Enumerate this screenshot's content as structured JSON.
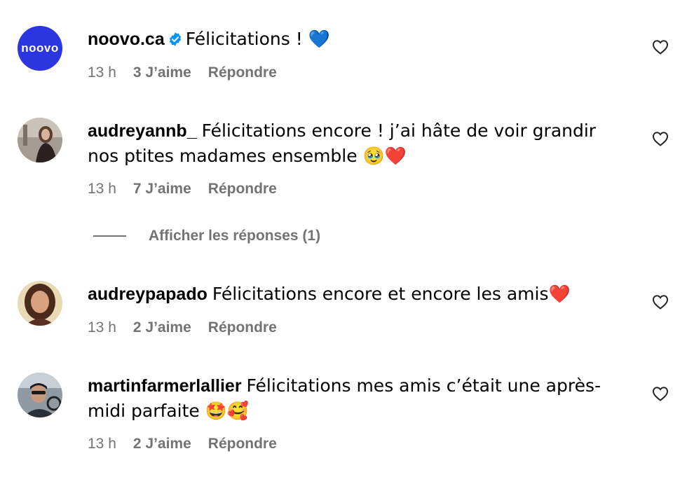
{
  "comments": [
    {
      "username": "noovo.ca",
      "avatar_text": "noovo",
      "verified": true,
      "text": "Félicitations ! 💙",
      "time": "13 h",
      "likes": "3 J’aime",
      "reply": "Répondre"
    },
    {
      "username": "audreyannb_",
      "text": "Félicitations encore ! j’ai hâte de voir grandir nos ptites madames ensemble 🥹❤️",
      "time": "13 h",
      "likes": "7 J’aime",
      "reply": "Répondre"
    },
    {
      "username": "audreypapado",
      "text": "Félicitations encore et encore les amis❤️",
      "time": "13 h",
      "likes": "2 J’aime",
      "reply": "Répondre"
    },
    {
      "username": "martinfarmerlallier",
      "text": "Félicitations mes amis c’était une après-midi parfaite 🤩🥰",
      "time": "13 h",
      "likes": "2 J’aime",
      "reply": "Répondre"
    }
  ],
  "view_replies": "Afficher les réponses (1)",
  "colors": {
    "verified": "#0095f6",
    "meta": "#737373",
    "noovo": "#2b35e0"
  },
  "icons": {
    "like": "heart-outline-icon",
    "verified": "verified-badge-icon"
  }
}
